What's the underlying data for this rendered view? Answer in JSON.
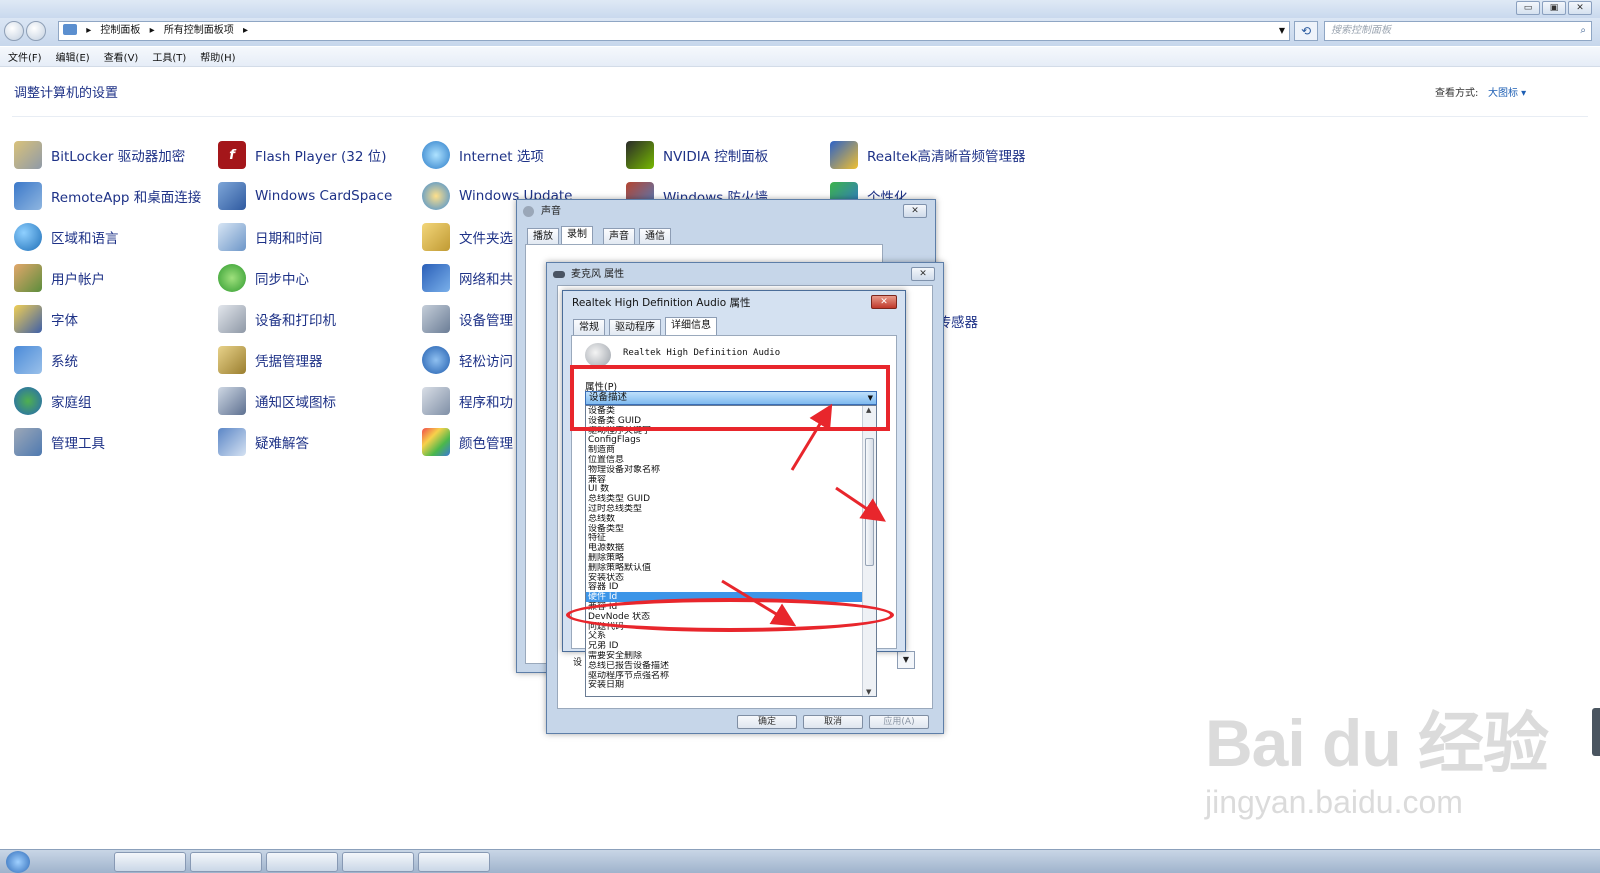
{
  "window": {
    "minimize": "▭",
    "maximize": "▣",
    "close": "✕"
  },
  "address": {
    "crumbs": [
      "控制面板",
      "所有控制面板项"
    ],
    "search_placeholder": "搜索控制面板"
  },
  "menu": [
    "文件(F)",
    "编辑(E)",
    "查看(V)",
    "工具(T)",
    "帮助(H)"
  ],
  "heading": "调整计算机的设置",
  "view_by": {
    "label": "查看方式:",
    "value": "大图标 ▾"
  },
  "items": {
    "bitlocker": "BitLocker 驱动器加密",
    "remoteapp": "RemoteApp 和桌面连接",
    "region": "区域和语言",
    "user": "用户帐户",
    "font": "字体",
    "system": "系统",
    "homegroup": "家庭组",
    "admin": "管理工具",
    "flash": "Flash Player (32 位)",
    "cardspace": "Windows CardSpace",
    "datetime": "日期和时间",
    "sync": "同步中心",
    "devices": "设备和打印机",
    "credential": "凭据管理器",
    "notify": "通知区域图标",
    "troubleshoot": "疑难解答",
    "internet": "Internet 选项",
    "update": "Windows Update",
    "folder": "文件夹选",
    "network": "网络和共",
    "devmgr": "设备管理",
    "access": "轻松访问",
    "programs": "程序和功",
    "color": "颜色管理",
    "nvidia": "NVIDIA 控制面板",
    "firewall": "Windows 防火墙",
    "realtek": "Realtek高清晰音频管理器",
    "personal": "个性化",
    "options_suffix": "选项",
    "sensor_suffix": "也传感器"
  },
  "sound_dialog": {
    "title": "声音",
    "tabs": [
      "播放",
      "录制",
      "声音",
      "通信"
    ]
  },
  "mic_dialog": {
    "title": "麦克风 属性",
    "ok": "确定",
    "cancel": "取消",
    "apply": "应用(A)",
    "label": "设"
  },
  "rt_dialog": {
    "title": "Realtek High Definition Audio 属性",
    "tabs": [
      "常规",
      "驱动程序",
      "详细信息"
    ],
    "device": "Realtek High Definition Audio",
    "property_label": "属性(P)",
    "property_value": "设备描述",
    "options": [
      "设备类",
      "设备类 GUID",
      "驱动程序关键字",
      "ConfigFlags",
      "制造商",
      "位置信息",
      "物理设备对象名称",
      "兼容",
      "UI 数",
      "总线类型 GUID",
      "过时总线类型",
      "总线数",
      "设备类型",
      "特征",
      "电源数据",
      "删除策略",
      "删除策略默认值",
      "安装状态",
      "容器 ID",
      "硬件 Id",
      "兼容 Id",
      "DevNode 状态",
      "问题代码",
      "父系",
      "兄弟 ID",
      "需要安全删除",
      "总线已报告设备描述",
      "驱动程序节点强名称",
      "安装日期"
    ],
    "selected_index": 19
  },
  "watermark": {
    "main": "Bai du 经验",
    "sub": "jingyan.baidu.com"
  }
}
